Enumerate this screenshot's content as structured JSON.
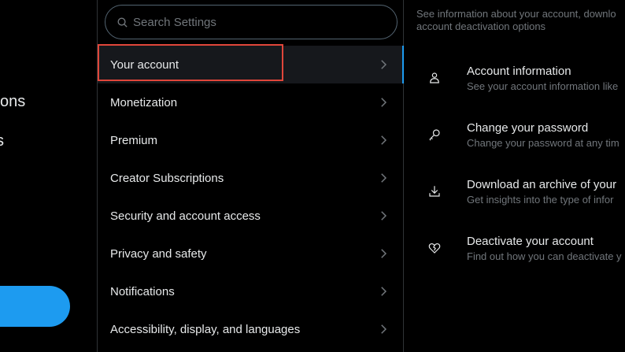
{
  "left_nav": {
    "frag1": "ons",
    "frag2": "s"
  },
  "search": {
    "placeholder": "Search Settings"
  },
  "menu": [
    {
      "label": "Your account"
    },
    {
      "label": "Monetization"
    },
    {
      "label": "Premium"
    },
    {
      "label": "Creator Subscriptions"
    },
    {
      "label": "Security and account access"
    },
    {
      "label": "Privacy and safety"
    },
    {
      "label": "Notifications"
    },
    {
      "label": "Accessibility, display, and languages"
    }
  ],
  "content": {
    "description_line1": "See information about your account, downlo",
    "description_line2": "account deactivation options",
    "options": [
      {
        "title": "Account information",
        "subtitle": "See your account information like",
        "icon": "user-icon"
      },
      {
        "title": "Change your password",
        "subtitle": "Change your password at any tim",
        "icon": "key-icon"
      },
      {
        "title": "Download an archive of your ",
        "subtitle": "Get insights into the type of infor",
        "icon": "download-icon"
      },
      {
        "title": "Deactivate your account",
        "subtitle": "Find out how you can deactivate y",
        "icon": "broken-heart-icon"
      }
    ]
  },
  "colors": {
    "accent": "#1d9bf0",
    "highlight": "#e0463a",
    "muted": "#71767b"
  }
}
